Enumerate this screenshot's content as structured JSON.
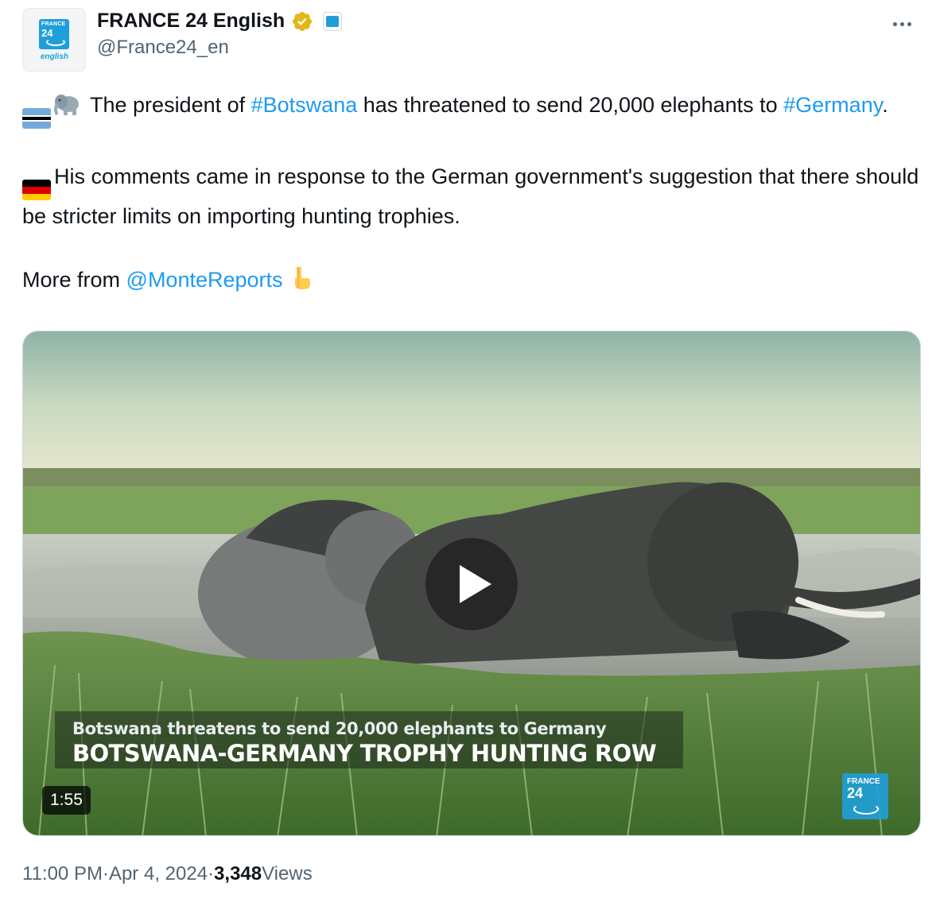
{
  "author": {
    "display_name": "FRANCE 24 English",
    "handle": "@France24_en",
    "avatar_text_top": "FRANCE",
    "avatar_text_num": "24",
    "avatar_text_bottom": "english"
  },
  "tweet": {
    "p1_prefix": " The president of ",
    "p1_tag1": "#Botswana",
    "p1_mid": " has threatened to send 20,000 elephants to ",
    "p1_tag2": "#Germany",
    "p1_suffix": ".",
    "p2_text": "His comments came in response to the German government's suggestion that there should be stricter limits on importing hunting trophies.",
    "p3_prefix": "More from ",
    "p3_mention": "@MonteReports"
  },
  "media": {
    "caption_small": "Botswana threatens to send 20,000 elephants to Germany",
    "caption_large": "BOTSWANA-GERMANY TROPHY HUNTING ROW",
    "duration": "1:55",
    "logo_top": "FRANCE",
    "logo_num": "24"
  },
  "meta": {
    "time": "11:00 PM",
    "separator": " · ",
    "date": "Apr 4, 2024",
    "views_count": "3,348",
    "views_label": " Views"
  },
  "colors": {
    "link": "#1d9bf0",
    "secondary_text": "#536471",
    "brand_blue": "#1f9fd9",
    "verified_gold": "#e2b719"
  },
  "icons": {
    "flag1": "botswana-flag-icon",
    "emoji1": "elephant-icon",
    "flag2": "germany-flag-icon",
    "emoji2": "pointing-down-icon",
    "badge": "verified-badge-icon",
    "more": "more-options-icon",
    "play": "play-icon"
  }
}
